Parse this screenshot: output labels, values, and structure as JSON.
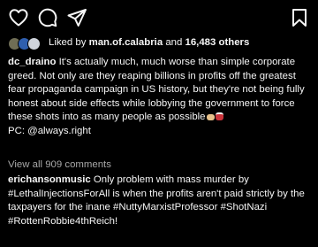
{
  "actions": {
    "like_icon": "heart-icon",
    "comment_icon": "comment-icon",
    "share_icon": "send-icon",
    "save_icon": "bookmark-icon"
  },
  "likes": {
    "prefix": "Liked by ",
    "user": "man.of.calabria",
    "middle": " and ",
    "count": "16,483 others"
  },
  "caption": {
    "username": "dc_draino",
    "text": " It's actually much, much worse than simple corporate greed. Not only are they reaping billions in profits off the greatest fear propaganda campaign in US history, but they're not being fully honest about side effects while lobbying the government to force these shots into as many people as possible",
    "emojis": [
      "#e6c08a",
      "#c9333a"
    ],
    "credit": "PC: @always.right"
  },
  "view_all": "View all 909 comments",
  "comment": {
    "username": "erichansonmusic",
    "text": " Only problem with mass murder by #LethalInjectionsForAll is when the profits aren't paid strictly by the taxpayers for the inane #NuttyMarxistProfessor #ShotNazi #RottenRobbie4thReich!"
  }
}
